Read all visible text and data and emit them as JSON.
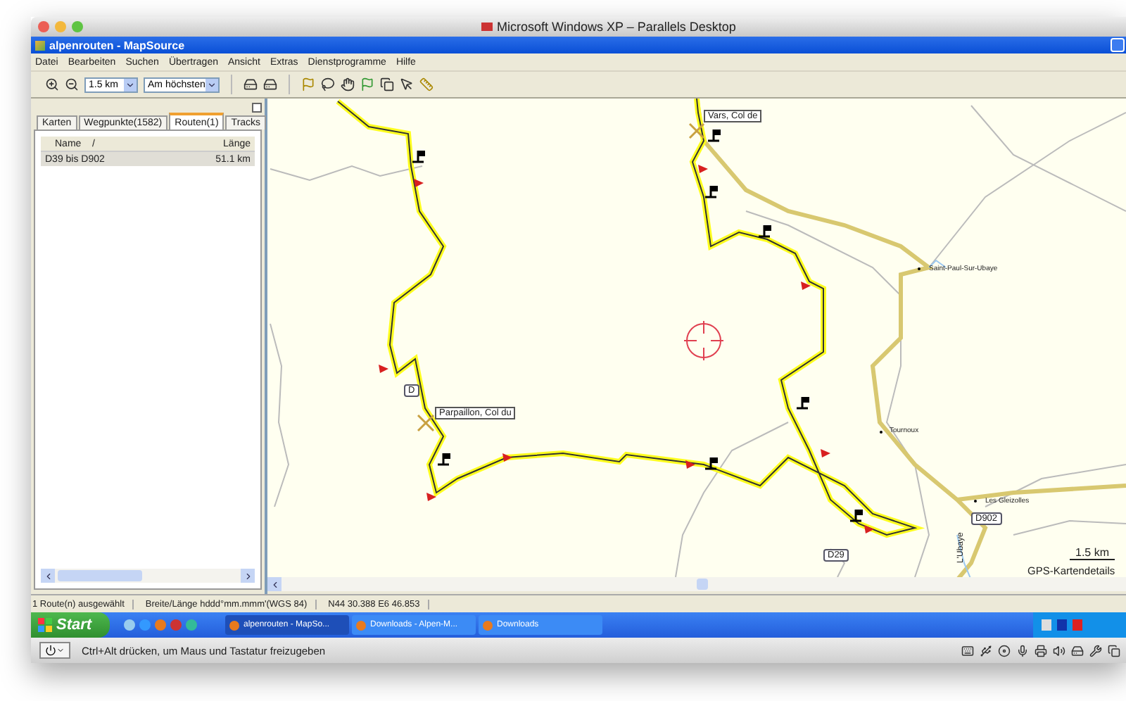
{
  "host_window": {
    "title": "Microsoft Windows XP – Parallels Desktop"
  },
  "app_window": {
    "title": "alpenrouten - MapSource"
  },
  "menu": [
    "Datei",
    "Bearbeiten",
    "Suchen",
    "Übertragen",
    "Ansicht",
    "Extras",
    "Dienstprogramme",
    "Hilfe"
  ],
  "toolbar": {
    "scale": "1.5 km",
    "detail": "Am höchsten"
  },
  "tabs": [
    {
      "label": "Karten",
      "selected": false
    },
    {
      "label": "Wegpunkte(1582)",
      "selected": false
    },
    {
      "label": "Routen(1)",
      "selected": true
    },
    {
      "label": "Tracks",
      "selected": false
    }
  ],
  "route_list": {
    "columns": [
      "Name",
      "Länge"
    ],
    "sort_mark": "/",
    "rows": [
      {
        "name": "D39 bis D902",
        "length": "51.1 km",
        "selected": true
      }
    ]
  },
  "map": {
    "labels": [
      {
        "kind": "pass",
        "text": "Vars, Col de"
      },
      {
        "kind": "road",
        "text": "D"
      },
      {
        "kind": "pass",
        "text": "Parpaillon, Col du"
      },
      {
        "kind": "town",
        "text": "Saint-Paul-Sur-Ubaye"
      },
      {
        "kind": "town",
        "text": "Tournoux"
      },
      {
        "kind": "town",
        "text": "Les Gleizolles"
      },
      {
        "kind": "road",
        "text": "D902"
      },
      {
        "kind": "river",
        "text": "L'Ubaye"
      },
      {
        "kind": "road",
        "text": "D29"
      }
    ],
    "scale": "1.5 km",
    "source": "GPS-Kartendetails"
  },
  "status_bar": [
    "1 Route(n) ausgewählt",
    "Breite/Länge hddd°mm.mmm'(WGS 84)",
    "N44 30.388 E6 46.853"
  ],
  "taskbar": {
    "start": "Start",
    "tasks": [
      {
        "label": "alpenrouten - MapSo...",
        "selected": true
      },
      {
        "label": "Downloads - Alpen-M...",
        "selected": false
      },
      {
        "label": "Downloads",
        "selected": false
      }
    ]
  },
  "vm_bar": {
    "message": "Ctrl+Alt drücken, um Maus und Tastatur freizugeben"
  }
}
